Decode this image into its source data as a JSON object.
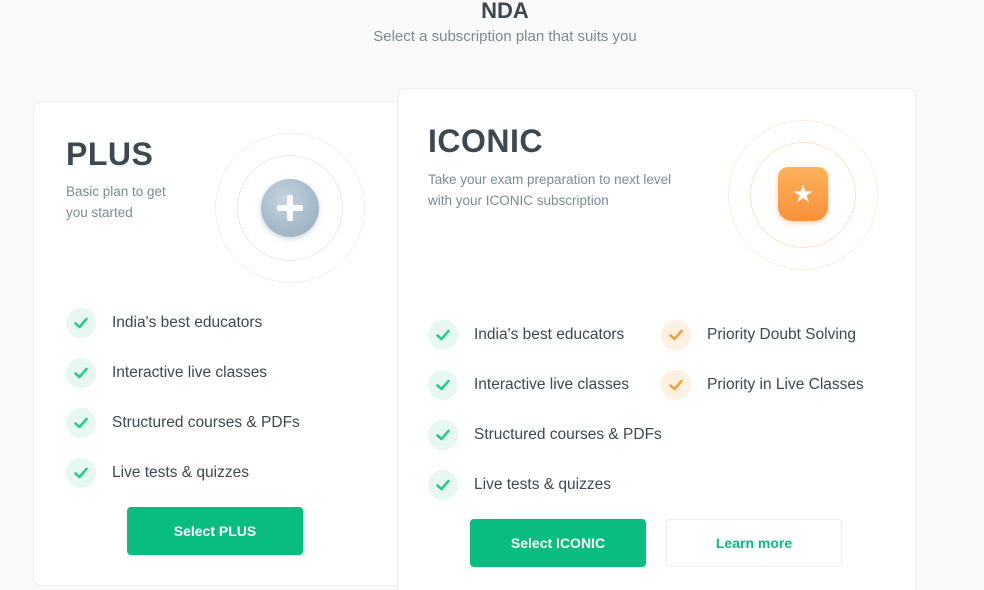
{
  "header": {
    "title": "NDA",
    "subtitle": "Select a subscription plan that suits you"
  },
  "plans": {
    "plus": {
      "name": "PLUS",
      "description_line1": "Basic plan to get",
      "description_line2": "you started",
      "features": [
        "India's best educators",
        "Interactive live classes",
        "Structured courses & PDFs",
        "Live tests & quizzes"
      ],
      "select_label": "Select PLUS",
      "icon": "plus-icon"
    },
    "iconic": {
      "name": "ICONIC",
      "description_line1": "Take your exam preparation to next level",
      "description_line2": "with your ICONIC subscription",
      "features": [
        "India's best educators",
        "Interactive live classes",
        "Structured courses & PDFs",
        "Live tests & quizzes"
      ],
      "extra_features": [
        "Priority Doubt Solving",
        "Priority in Live Classes"
      ],
      "select_label": "Select ICONIC",
      "learn_more_label": "Learn more",
      "icon": "star-icon"
    }
  },
  "colors": {
    "accent_green": "#08bd80",
    "accent_orange": "#f7913a",
    "text_dark": "#3c4852",
    "text_muted": "#7a8b94"
  }
}
